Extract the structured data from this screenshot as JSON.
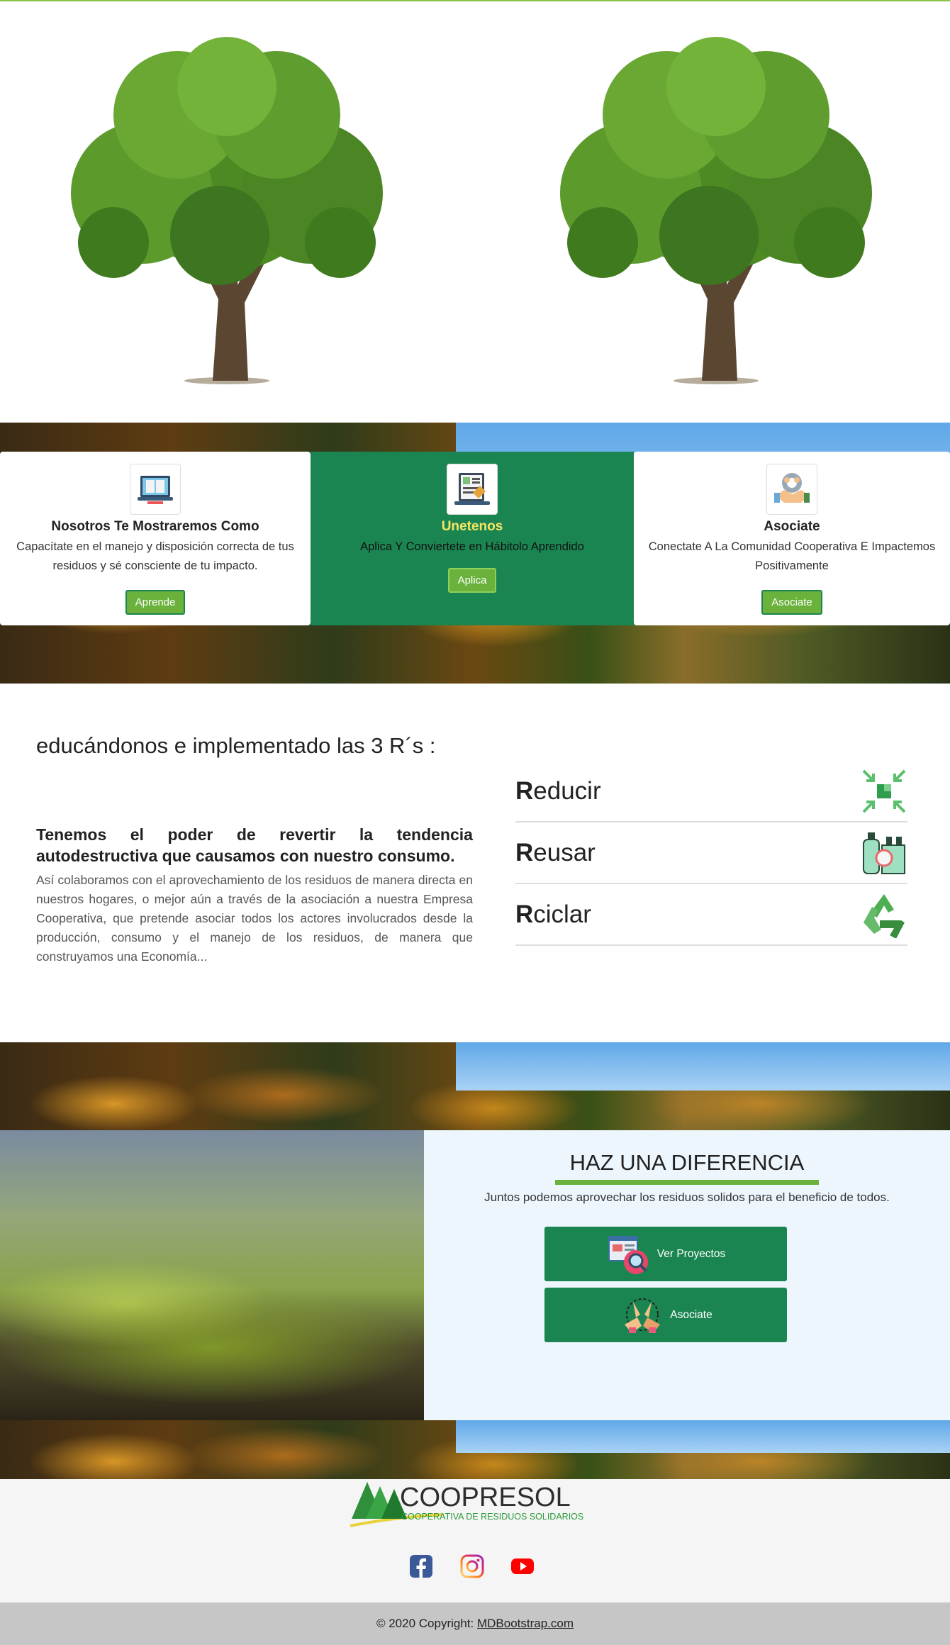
{
  "cards": [
    {
      "title": "Nosotros Te Mostraremos Como",
      "text": "Capacítate en el manejo y disposición correcta de tus residuos y sé consciente de tu impacto.",
      "button": "Aprende",
      "icon": "book-laptop-icon"
    },
    {
      "title": "Unetenos",
      "text": "Aplica Y Conviertete en Hábitolo Aprendido",
      "button": "Aplica",
      "icon": "application-form-icon"
    },
    {
      "title": "Asociate",
      "text": "Conectate A La Comunidad Cooperativa E Impactemos Positivamente",
      "button": "Asociate",
      "icon": "handshake-gear-icon"
    }
  ],
  "rs": {
    "title": "educándonos e implementado las 3 R´s :",
    "subtitle_line1": [
      "Tenemos",
      "el",
      "poder",
      "de",
      "revertir",
      "la",
      "tendencia"
    ],
    "subtitle_line2": "autodestructiva que causamos con nuestro consumo.",
    "body": "Así colaboramos con el aprovechamiento de los residuos de manera directa en nuestros hogares, o mejor aún a través de la asociación a nuestra Empresa Cooperativa, que pretende asociar todos los actores involucrados desde la producción, consumo y el manejo de los residuos, de manera que construyamos una Economía...",
    "items": [
      {
        "initial": "R",
        "rest": "educir",
        "icon": "reduce-arrows-icon"
      },
      {
        "initial": "R",
        "rest": "eusar",
        "icon": "reuse-bottles-icon"
      },
      {
        "initial": "R",
        "rest": "ciclar",
        "icon": "recycle-icon"
      }
    ]
  },
  "diferencia": {
    "title": "HAZ UNA DIFERENCIA",
    "text": "Juntos podemos aprovechar los residuos solidos para el beneficio de todos.",
    "buttons": [
      {
        "label": "Ver Proyectos",
        "icon": "search-document-icon"
      },
      {
        "label": "Asociate",
        "icon": "joined-hands-icon"
      }
    ]
  },
  "footer": {
    "logo_name": "COOPRESOL",
    "logo_tagline": "COOPERATIVA DE RESIDUOS SOLIDARIOS",
    "social": [
      "facebook-icon",
      "instagram-icon",
      "youtube-icon"
    ],
    "copyright_prefix": "© 2020 Copyright:",
    "copyright_link": "MDBootstrap.com"
  },
  "colors": {
    "primary_green": "#1b8551",
    "accent_green": "#6ab23c",
    "title_yellow": "#f5e663"
  }
}
